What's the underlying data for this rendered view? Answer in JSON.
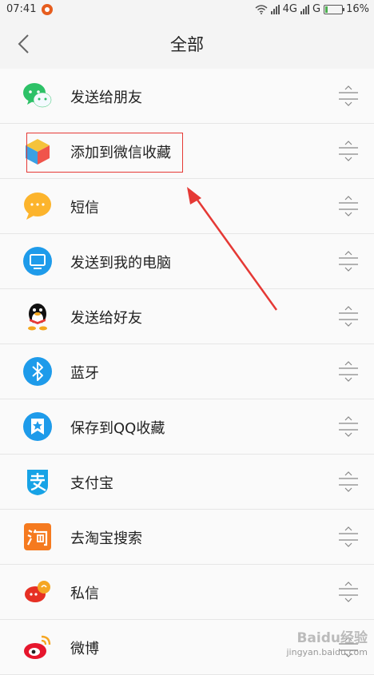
{
  "status_bar": {
    "time": "07:41",
    "network": "4G",
    "network2": "G",
    "battery_percent": "16%",
    "battery_level": 0.16
  },
  "header": {
    "title": "全部"
  },
  "items": [
    {
      "label": "发送给朋友",
      "icon": "wechat-icon"
    },
    {
      "label": "添加到微信收藏",
      "icon": "cube-icon"
    },
    {
      "label": "短信",
      "icon": "sms-icon"
    },
    {
      "label": "发送到我的电脑",
      "icon": "computer-icon"
    },
    {
      "label": "发送给好友",
      "icon": "qq-penguin-icon"
    },
    {
      "label": "蓝牙",
      "icon": "bluetooth-icon"
    },
    {
      "label": "保存到QQ收藏",
      "icon": "qq-favorites-icon"
    },
    {
      "label": "支付宝",
      "icon": "alipay-icon"
    },
    {
      "label": "去淘宝搜索",
      "icon": "taobao-icon"
    },
    {
      "label": "私信",
      "icon": "private-message-icon"
    },
    {
      "label": "微博",
      "icon": "weibo-icon"
    }
  ],
  "watermark": {
    "brand": "Baidu经验",
    "url": "jingyan.baidu.com"
  },
  "colors": {
    "annotation_red": "#e53935",
    "accent_orange": "#e65d1e"
  }
}
